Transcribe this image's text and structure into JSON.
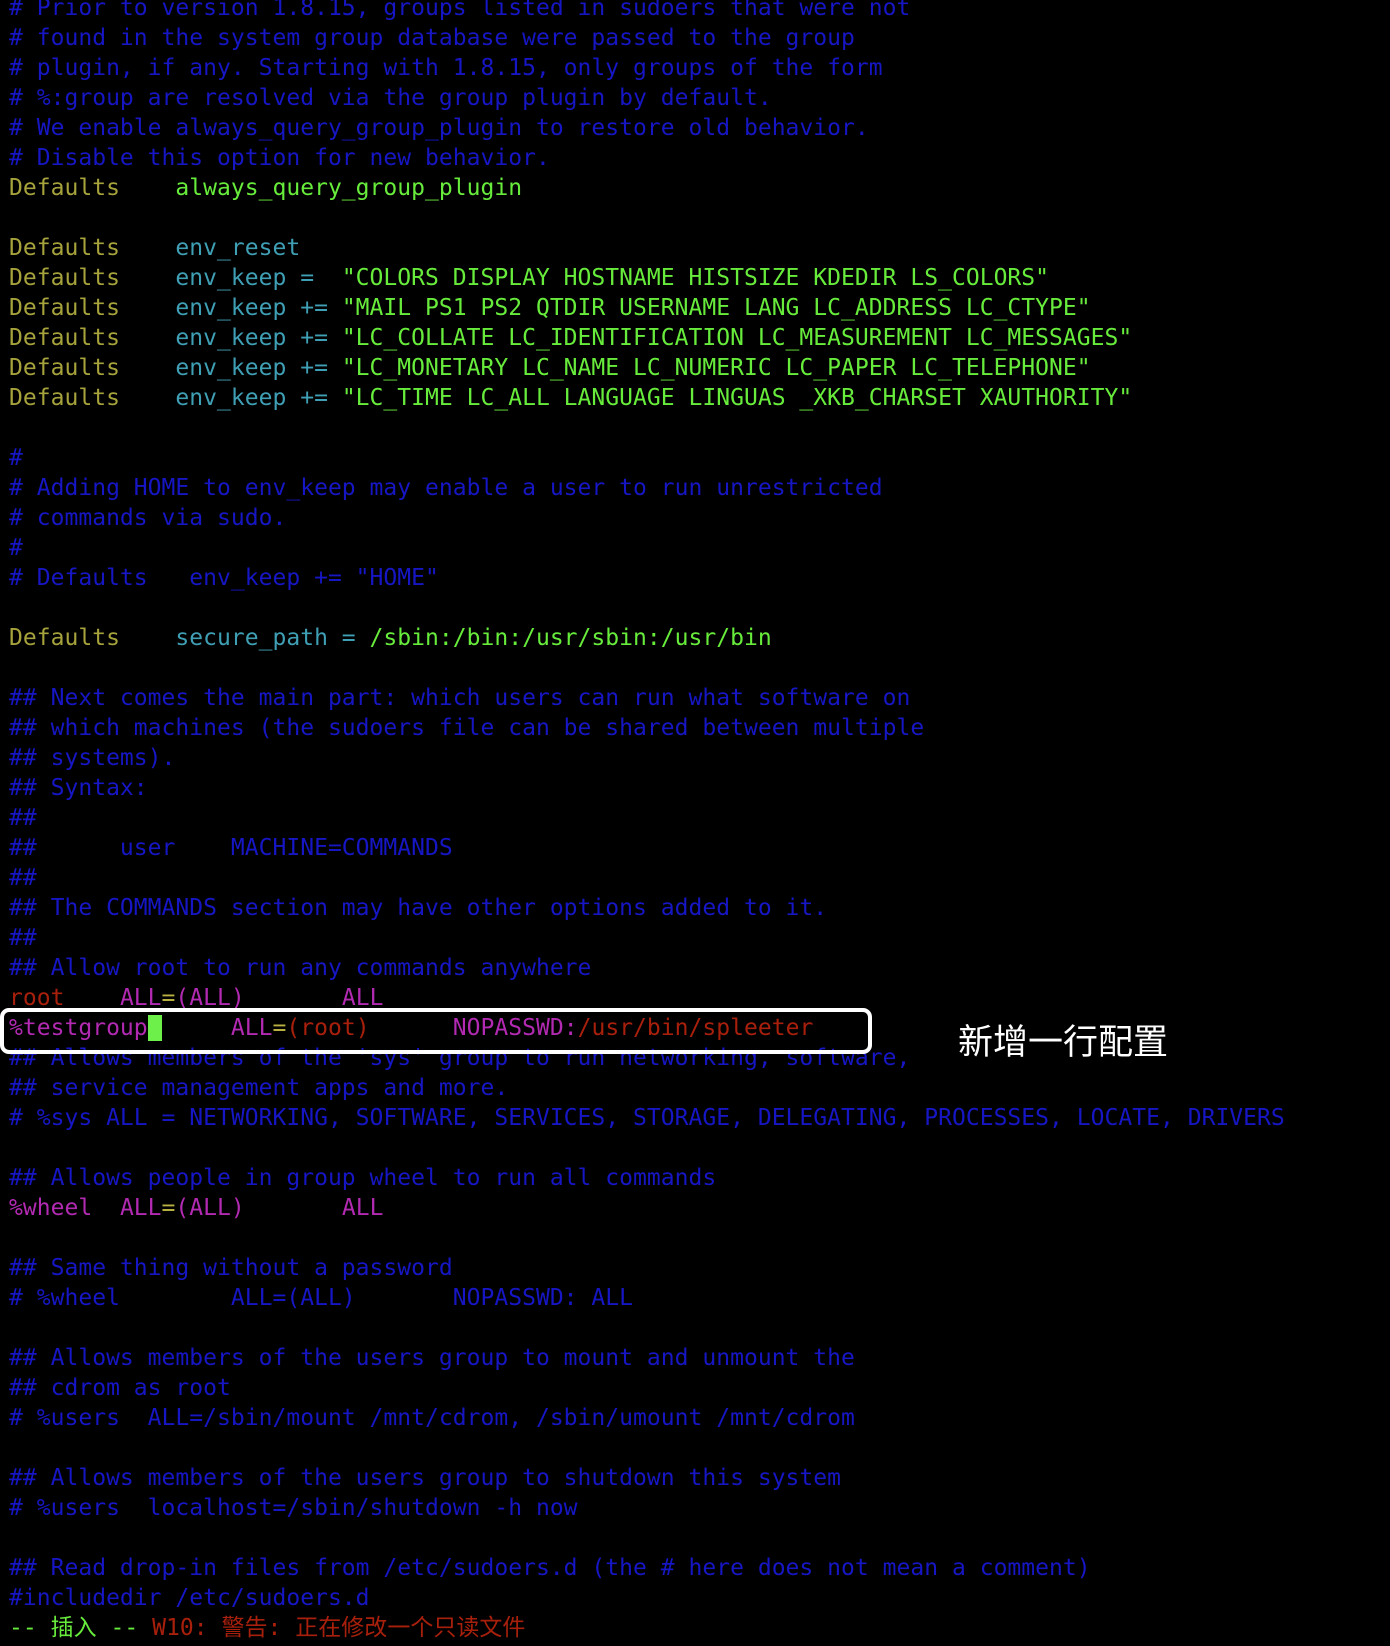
{
  "colors": {
    "comment": "#1616c4",
    "keyword": "#a6a23c",
    "string": "#68ec3c",
    "option": "#3f9fb4",
    "user": "#b22ab2",
    "path": "#a8200c",
    "cursor": "#6ef04a",
    "annotation": "#ffffff"
  },
  "annotation": "新增一行配置",
  "lines": [
    [
      {
        "t": "# Prior to version 1.8.15, groups listed in sudoers that were not",
        "c": "c"
      }
    ],
    [
      {
        "t": "# found in the system group database were passed to the group",
        "c": "c"
      }
    ],
    [
      {
        "t": "# plugin, if any. Starting with 1.8.15, only groups of the form",
        "c": "c"
      }
    ],
    [
      {
        "t": "# %:group are resolved via the group plugin by default.",
        "c": "c"
      }
    ],
    [
      {
        "t": "# We enable always_query_group_plugin to restore old behavior.",
        "c": "c"
      }
    ],
    [
      {
        "t": "# Disable this option for new behavior.",
        "c": "c"
      }
    ],
    [
      {
        "t": "Defaults",
        "c": "d"
      },
      {
        "t": "    ",
        "c": ""
      },
      {
        "t": "always_query_group_plugin",
        "c": "g"
      }
    ],
    [],
    [
      {
        "t": "Defaults",
        "c": "d"
      },
      {
        "t": "    ",
        "c": ""
      },
      {
        "t": "env_reset",
        "c": "t"
      }
    ],
    [
      {
        "t": "Defaults",
        "c": "d"
      },
      {
        "t": "    ",
        "c": ""
      },
      {
        "t": "env_keep =  ",
        "c": "t"
      },
      {
        "t": "\"COLORS DISPLAY HOSTNAME HISTSIZE KDEDIR LS_COLORS\"",
        "c": "g"
      }
    ],
    [
      {
        "t": "Defaults",
        "c": "d"
      },
      {
        "t": "    ",
        "c": ""
      },
      {
        "t": "env_keep += ",
        "c": "t"
      },
      {
        "t": "\"MAIL PS1 PS2 QTDIR USERNAME LANG LC_ADDRESS LC_CTYPE\"",
        "c": "g"
      }
    ],
    [
      {
        "t": "Defaults",
        "c": "d"
      },
      {
        "t": "    ",
        "c": ""
      },
      {
        "t": "env_keep += ",
        "c": "t"
      },
      {
        "t": "\"LC_COLLATE LC_IDENTIFICATION LC_MEASUREMENT LC_MESSAGES\"",
        "c": "g"
      }
    ],
    [
      {
        "t": "Defaults",
        "c": "d"
      },
      {
        "t": "    ",
        "c": ""
      },
      {
        "t": "env_keep += ",
        "c": "t"
      },
      {
        "t": "\"LC_MONETARY LC_NAME LC_NUMERIC LC_PAPER LC_TELEPHONE\"",
        "c": "g"
      }
    ],
    [
      {
        "t": "Defaults",
        "c": "d"
      },
      {
        "t": "    ",
        "c": ""
      },
      {
        "t": "env_keep += ",
        "c": "t"
      },
      {
        "t": "\"LC_TIME LC_ALL LANGUAGE LINGUAS _XKB_CHARSET XAUTHORITY\"",
        "c": "g"
      }
    ],
    [],
    [
      {
        "t": "#",
        "c": "c"
      }
    ],
    [
      {
        "t": "# Adding HOME to env_keep may enable a user to run unrestricted",
        "c": "c"
      }
    ],
    [
      {
        "t": "# commands via sudo.",
        "c": "c"
      }
    ],
    [
      {
        "t": "#",
        "c": "c"
      }
    ],
    [
      {
        "t": "# Defaults   env_keep += \"HOME\"",
        "c": "c"
      }
    ],
    [],
    [
      {
        "t": "Defaults",
        "c": "d"
      },
      {
        "t": "    ",
        "c": ""
      },
      {
        "t": "secure_path = ",
        "c": "t"
      },
      {
        "t": "/sbin:/bin:/usr/sbin:/usr/bin",
        "c": "g"
      }
    ],
    [],
    [
      {
        "t": "## Next comes the main part: which users can run what software on",
        "c": "c"
      }
    ],
    [
      {
        "t": "## which machines (the sudoers file can be shared between multiple",
        "c": "c"
      }
    ],
    [
      {
        "t": "## systems).",
        "c": "c"
      }
    ],
    [
      {
        "t": "## Syntax:",
        "c": "c"
      }
    ],
    [
      {
        "t": "##",
        "c": "c"
      }
    ],
    [
      {
        "t": "##      user    MACHINE=COMMANDS",
        "c": "c"
      }
    ],
    [
      {
        "t": "##",
        "c": "c"
      }
    ],
    [
      {
        "t": "## The COMMANDS section may have other options added to it.",
        "c": "c"
      }
    ],
    [
      {
        "t": "##",
        "c": "c"
      }
    ],
    [
      {
        "t": "## Allow root to run any commands anywhere",
        "c": "c"
      }
    ],
    [
      {
        "t": "root",
        "c": "r"
      },
      {
        "t": "    ",
        "c": ""
      },
      {
        "t": "ALL",
        "c": "m"
      },
      {
        "t": "=",
        "c": "y"
      },
      {
        "t": "(ALL)",
        "c": "m"
      },
      {
        "t": "       ",
        "c": ""
      },
      {
        "t": "ALL",
        "c": "m"
      }
    ],
    [
      {
        "t": "%testgroup",
        "c": "m"
      },
      {
        "t": " ",
        "c": "cursor"
      },
      {
        "t": "     ",
        "c": ""
      },
      {
        "t": "ALL",
        "c": "m"
      },
      {
        "t": "=",
        "c": "y"
      },
      {
        "t": "(root)",
        "c": "r"
      },
      {
        "t": "      ",
        "c": ""
      },
      {
        "t": "NOPASSWD:",
        "c": "m"
      },
      {
        "t": "/usr/bin/spleeter",
        "c": "r"
      }
    ],
    [
      {
        "t": "## Allows members of the 'sys' group to run networking, software,",
        "c": "c"
      }
    ],
    [
      {
        "t": "## service management apps and more.",
        "c": "c"
      }
    ],
    [
      {
        "t": "# %sys ALL = NETWORKING, SOFTWARE, SERVICES, STORAGE, DELEGATING, PROCESSES, LOCATE, DRIVERS",
        "c": "c"
      }
    ],
    [],
    [
      {
        "t": "## Allows people in group wheel to run all commands",
        "c": "c"
      }
    ],
    [
      {
        "t": "%wheel",
        "c": "m"
      },
      {
        "t": "  ",
        "c": ""
      },
      {
        "t": "ALL",
        "c": "m"
      },
      {
        "t": "=",
        "c": "y"
      },
      {
        "t": "(ALL)",
        "c": "m"
      },
      {
        "t": "       ",
        "c": ""
      },
      {
        "t": "ALL",
        "c": "m"
      }
    ],
    [],
    [
      {
        "t": "## Same thing without a password",
        "c": "c"
      }
    ],
    [
      {
        "t": "# %wheel        ALL=(ALL)       NOPASSWD: ALL",
        "c": "c"
      }
    ],
    [],
    [
      {
        "t": "## Allows members of the users group to mount and unmount the",
        "c": "c"
      }
    ],
    [
      {
        "t": "## cdrom as root",
        "c": "c"
      }
    ],
    [
      {
        "t": "# %users  ALL=/sbin/mount /mnt/cdrom, /sbin/umount /mnt/cdrom",
        "c": "c"
      }
    ],
    [],
    [
      {
        "t": "## Allows members of the users group to shutdown this system",
        "c": "c"
      }
    ],
    [
      {
        "t": "# %users  localhost=/sbin/shutdown -h now",
        "c": "c"
      }
    ],
    [],
    [
      {
        "t": "## Read drop-in files from /etc/sudoers.d (the # here does not mean a comment)",
        "c": "c"
      }
    ],
    [
      {
        "t": "#includedir /etc/sudoers.d",
        "c": "c"
      }
    ]
  ],
  "status": {
    "mode": "-- 插入 --",
    "warning": "W10: 警告: 正在修改一个只读文件"
  }
}
